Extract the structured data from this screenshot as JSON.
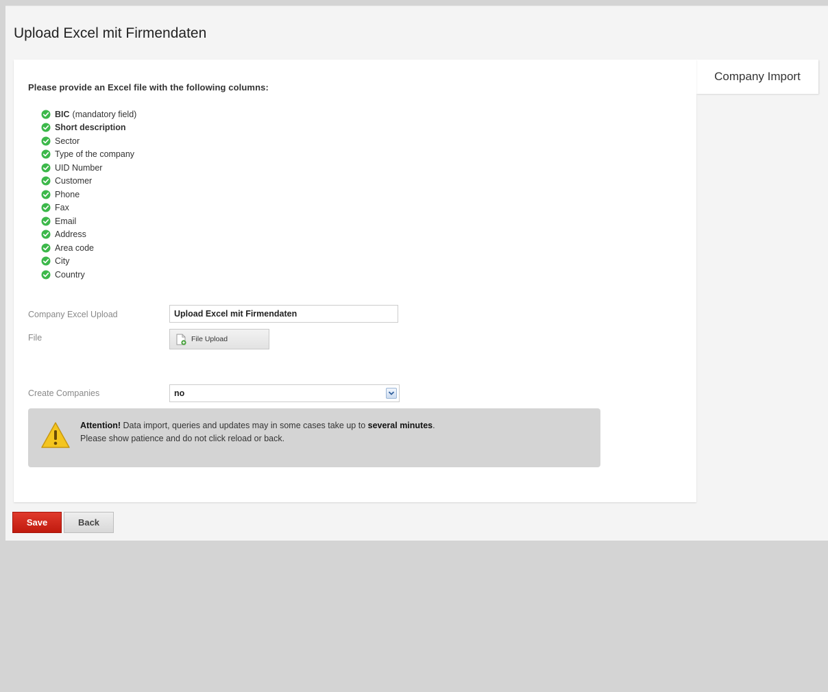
{
  "page": {
    "title": "Upload Excel mit Firmendaten"
  },
  "side_tab": {
    "label": "Company Import"
  },
  "intro": "Please provide an Excel file with the following columns:",
  "columns": [
    {
      "name": "BIC",
      "note": "(mandatory field)",
      "bold": true
    },
    {
      "name": "Short description",
      "note": "",
      "bold": true
    },
    {
      "name": "Sector",
      "note": "",
      "bold": false
    },
    {
      "name": "Type of the company",
      "note": "",
      "bold": false
    },
    {
      "name": "UID Number",
      "note": "",
      "bold": false
    },
    {
      "name": "Customer",
      "note": "",
      "bold": false
    },
    {
      "name": "Phone",
      "note": "",
      "bold": false
    },
    {
      "name": "Fax",
      "note": "",
      "bold": false
    },
    {
      "name": "Email",
      "note": "",
      "bold": false
    },
    {
      "name": "Address",
      "note": "",
      "bold": false
    },
    {
      "name": "Area code",
      "note": "",
      "bold": false
    },
    {
      "name": "City",
      "note": "",
      "bold": false
    },
    {
      "name": "Country",
      "note": "",
      "bold": false
    }
  ],
  "form": {
    "upload_label": "Company Excel Upload",
    "upload_value": "Upload Excel mit Firmendaten",
    "file_label": "File",
    "file_button": "File Upload",
    "create_label": "Create Companies",
    "create_value": "no"
  },
  "attention": {
    "prefix": "Attention!",
    "text_before": " Data import, queries and updates may in some cases take up to ",
    "emphasis": "several minutes",
    "text_after": ".",
    "line2": "Please show patience and do not click reload or back."
  },
  "buttons": {
    "save": "Save",
    "back": "Back"
  },
  "colors": {
    "check_green": "#3cb84a",
    "save_red": "#d0261a",
    "warning_yellow": "#f4c51f"
  },
  "icons": {
    "check": "check-circle-icon",
    "file": "file-add-icon",
    "dropdown": "chevron-down-icon",
    "warning": "warning-triangle-icon"
  }
}
